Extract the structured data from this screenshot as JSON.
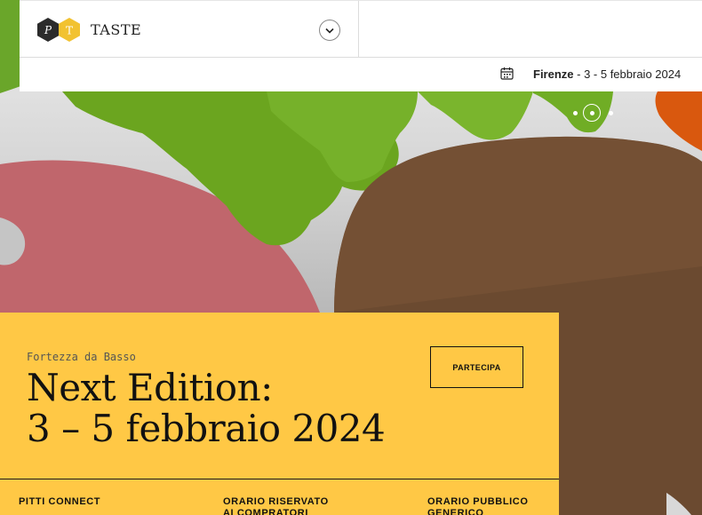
{
  "header": {
    "brand_name": "TASTE",
    "logo_letters": [
      "P",
      "T"
    ]
  },
  "infobar": {
    "city": "Firenze",
    "dates": " - 3 - 5 febbraio 2024"
  },
  "carousel": {
    "dots": 3,
    "active_index": 1
  },
  "panel": {
    "venue": "Fortezza da Basso",
    "headline_line1": "Next Edition:",
    "headline_line2": "3 – 5 febbraio 2024",
    "cta_label": "PARTECIPA"
  },
  "footer_columns": [
    {
      "label": "PITTI CONNECT"
    },
    {
      "label": "ORARIO RISERVATO AI COMPRATORI"
    },
    {
      "label": "ORARIO PUBBLICO GENERICO"
    }
  ],
  "colors": {
    "panel": "#ffc845",
    "brand_yellow": "#f2c230",
    "brand_dark": "#2b2b2b"
  }
}
